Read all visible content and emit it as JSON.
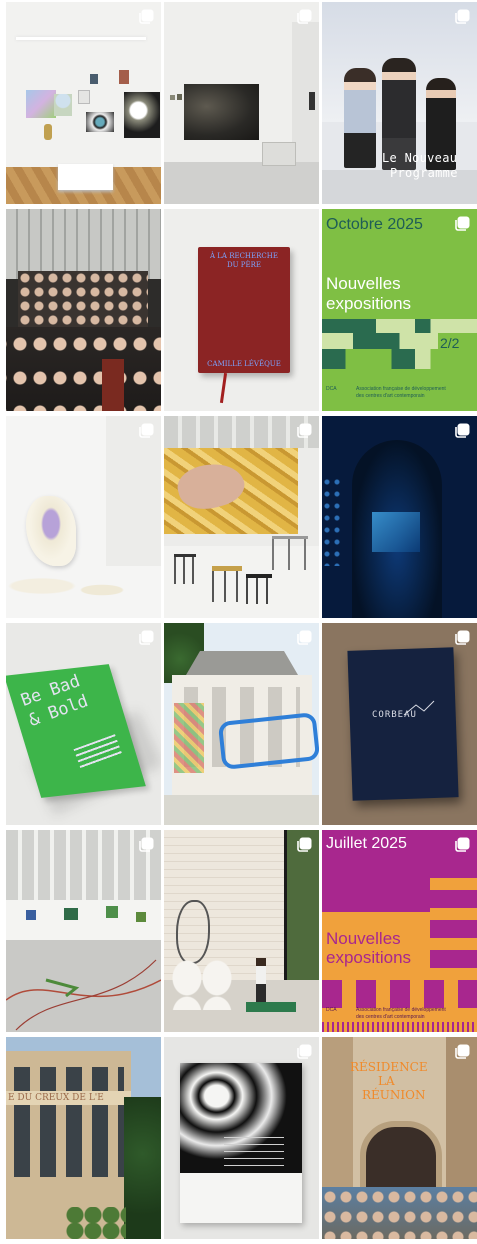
{
  "posts": [
    {
      "id": "gallery-white-walls"
    },
    {
      "id": "gallery-dark-photo"
    },
    {
      "id": "team-portrait",
      "overlay_line1": "Le Nouveau",
      "overlay_line2": "Programme"
    },
    {
      "id": "group-photo"
    },
    {
      "id": "red-book",
      "book_title_line1": "À LA RECHERCHE",
      "book_title_line2": "DU PÈRE",
      "book_author": "CAMILLE LÉVÊQUE"
    },
    {
      "id": "october-poster",
      "month": "Octobre 2025",
      "headline_line1": "Nouvelles",
      "headline_line2": "expositions",
      "page": "2/2",
      "org_short": "DCA",
      "org_line1": "Association française de développement",
      "org_line2": "des centres d'art contemporain"
    },
    {
      "id": "white-sculpture"
    },
    {
      "id": "hand-mural"
    },
    {
      "id": "dark-installation"
    },
    {
      "id": "green-book",
      "title_line1": "Be Bad",
      "title_line2": "& Bold"
    },
    {
      "id": "villa-painted"
    },
    {
      "id": "navy-book",
      "title": "CORBEAU"
    },
    {
      "id": "floor-installation"
    },
    {
      "id": "performer-room"
    },
    {
      "id": "july-poster",
      "month": "Juillet 2025",
      "headline_line1": "Nouvelles",
      "headline_line2": "expositions",
      "org_short": "DCA",
      "org_line1": "Association française de développement",
      "org_line2": "des centres d'art contemporain"
    },
    {
      "id": "factory-building",
      "sign_text": "E DU CREUX DE L'E"
    },
    {
      "id": "bw-publication"
    },
    {
      "id": "residence-poster",
      "line1": "RÉSIDENCE",
      "line2": "LA",
      "line3": "RÉUNION"
    }
  ]
}
